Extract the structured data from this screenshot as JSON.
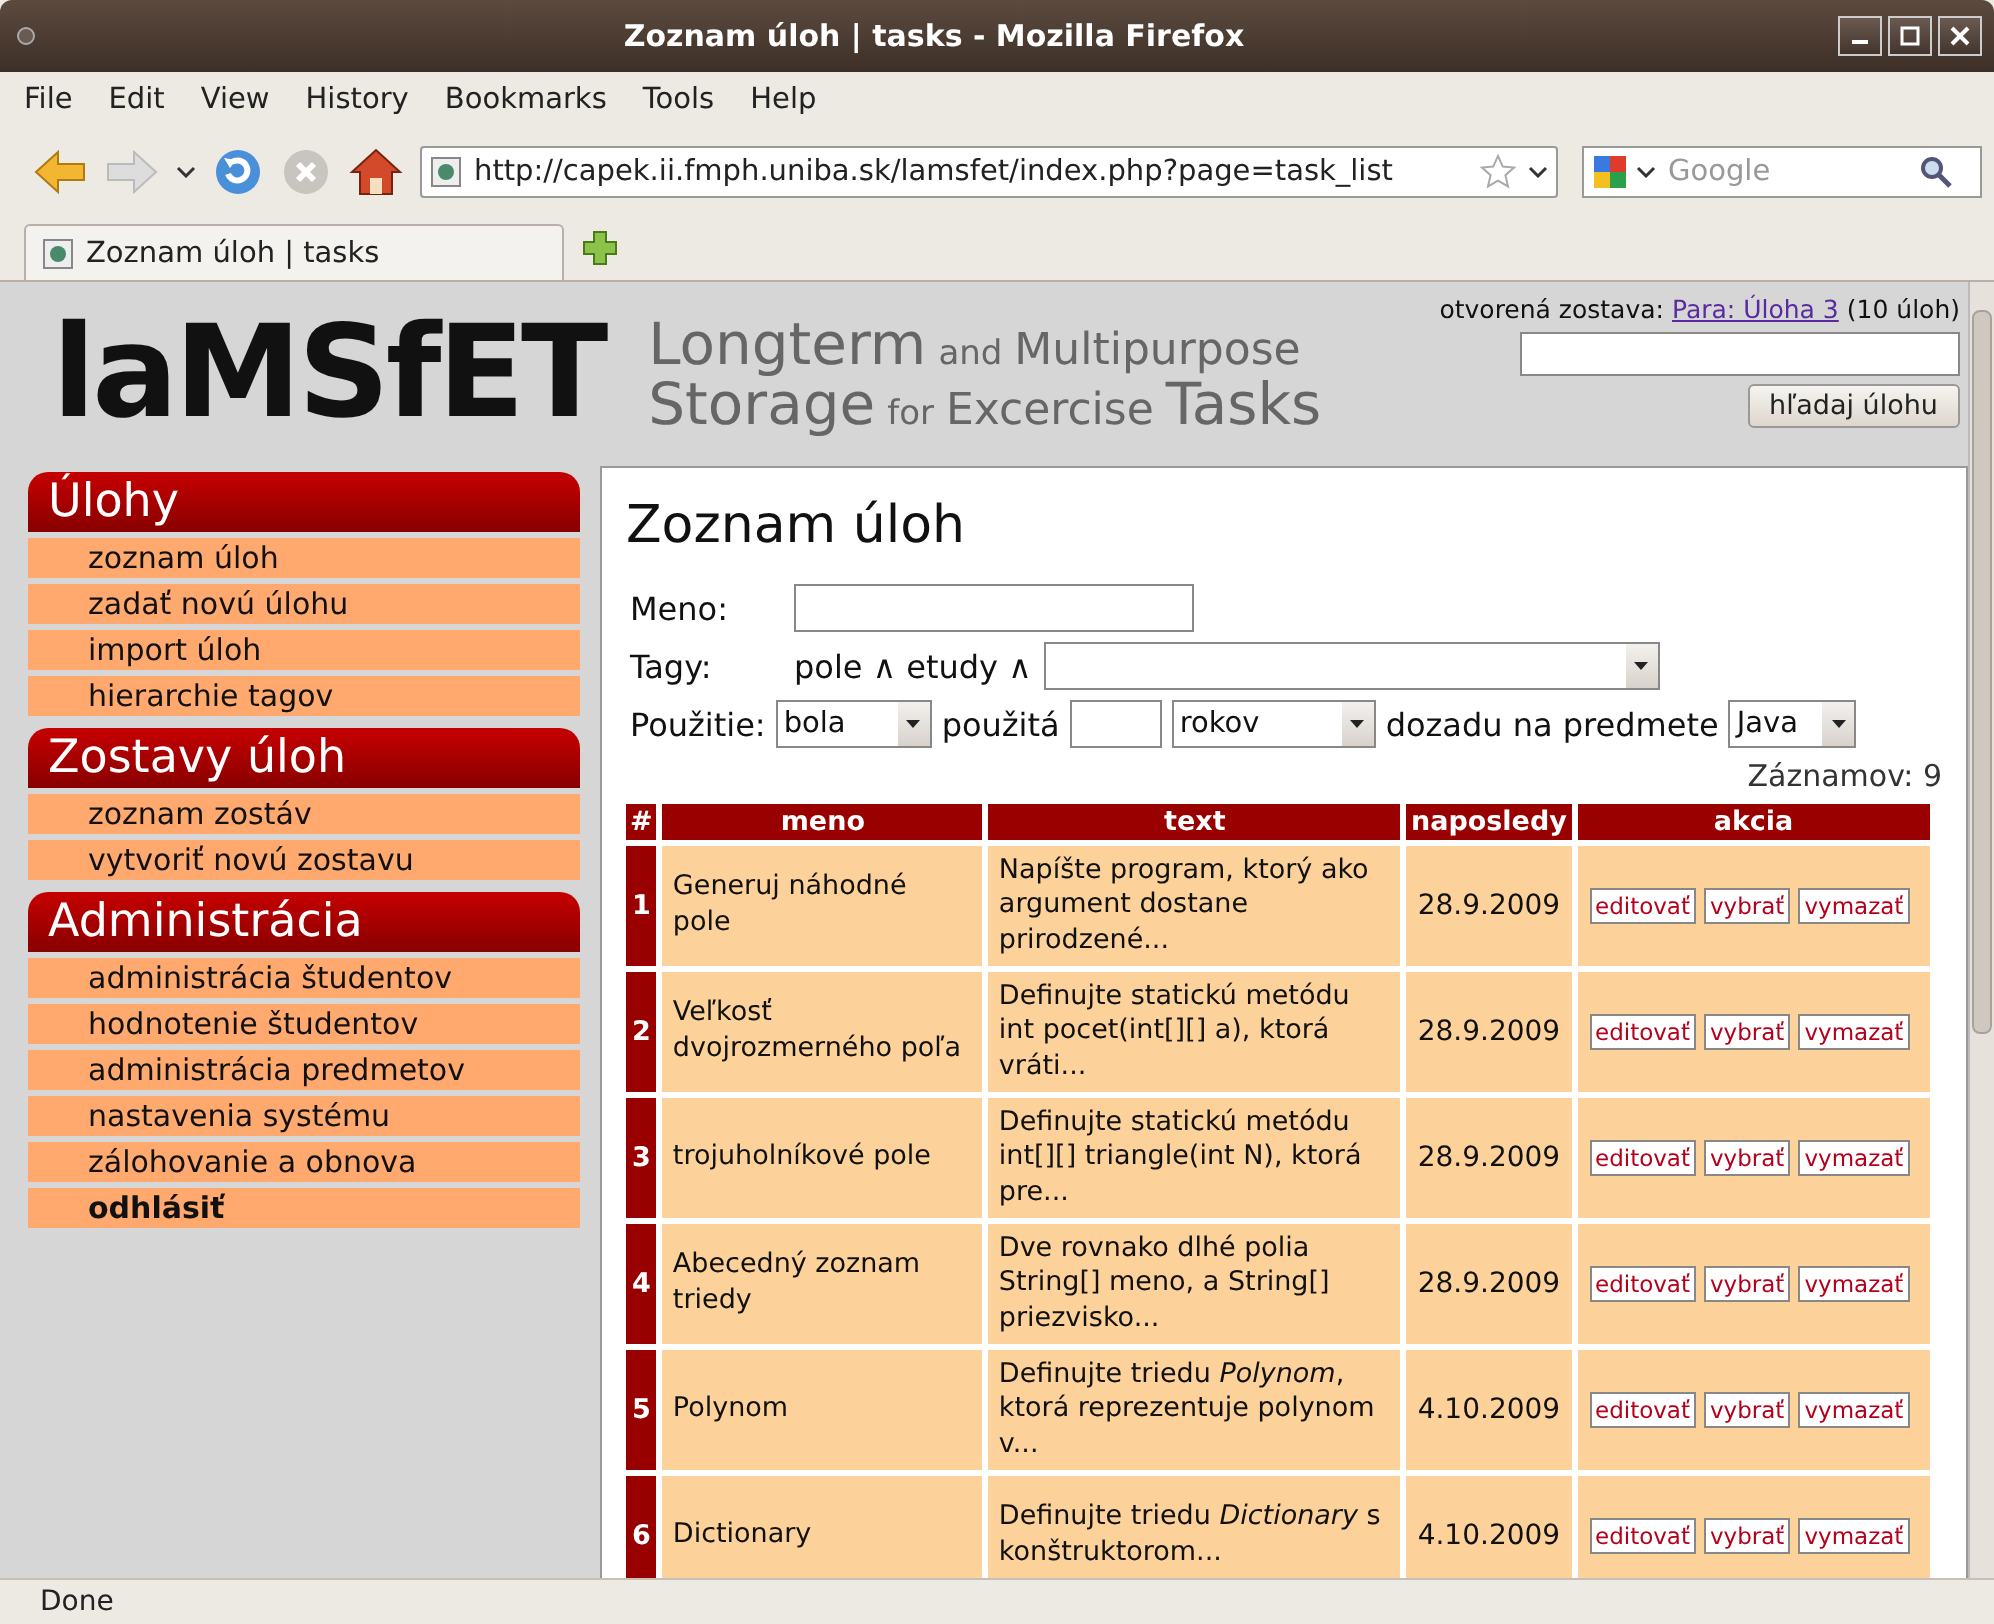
{
  "window": {
    "title": "Zoznam úloh | tasks - Mozilla Firefox"
  },
  "menu": [
    "File",
    "Edit",
    "View",
    "History",
    "Bookmarks",
    "Tools",
    "Help"
  ],
  "toolbar": {
    "url": "http://capek.ii.fmph.uniba.sk/lamsfet/index.php?page=task_list",
    "search_placeholder": "Google"
  },
  "tabs": [
    {
      "label": "Zoznam úloh | tasks",
      "selected": true
    }
  ],
  "header": {
    "logo": "laMSfET",
    "tagline": [
      [
        {
          "text": "Longterm",
          "kind": "big"
        },
        {
          "text": "and",
          "kind": "small"
        },
        {
          "text": "Multipurpose",
          "kind": "mid"
        }
      ],
      [
        {
          "text": "Storage",
          "kind": "big"
        },
        {
          "text": "for",
          "kind": "small"
        },
        {
          "text": "Excercise",
          "kind": "mid"
        },
        {
          "text": "Tasks",
          "kind": "big"
        }
      ]
    ],
    "open_set_label": "otvorená zostava:",
    "open_set_link": "Para: Úloha 3",
    "open_set_count": "(10 úloh)",
    "search_button": "hľadaj úlohu"
  },
  "sidebar": [
    {
      "title": "Úlohy",
      "items": [
        {
          "label": "zoznam úloh",
          "bold": false
        },
        {
          "label": "zadať novú úlohu",
          "bold": false
        },
        {
          "label": "import úloh",
          "bold": false
        },
        {
          "label": "hierarchie tagov",
          "bold": false
        }
      ]
    },
    {
      "title": "Zostavy úloh",
      "items": [
        {
          "label": "zoznam zostáv",
          "bold": false
        },
        {
          "label": "vytvoriť novú zostavu",
          "bold": false
        }
      ]
    },
    {
      "title": "Administrácia",
      "items": [
        {
          "label": "administrácia študentov",
          "bold": false
        },
        {
          "label": "hodnotenie študentov",
          "bold": false
        },
        {
          "label": "administrácia predmetov",
          "bold": false
        },
        {
          "label": "nastavenia systému",
          "bold": false
        },
        {
          "label": "zálohovanie a obnova",
          "bold": false
        },
        {
          "label": "odhlásiť",
          "bold": true
        }
      ]
    }
  ],
  "main": {
    "title": "Zoznam úloh",
    "filters": {
      "name_label": "Meno:",
      "tags_label": "Tagy:",
      "tags": "pole ∧ etudy ∧",
      "usage_label": "Použitie:",
      "usage_select": "bola",
      "used_label": "použitá",
      "years_select": "rokov",
      "back_label": "dozadu na predmete",
      "subject_select": "Java"
    },
    "count": "Záznamov: 9",
    "table": {
      "columns": [
        "#",
        "meno",
        "text",
        "naposledy",
        "akcia"
      ],
      "rows": [
        {
          "num": "1",
          "name": "Generuj náhodné pole",
          "text": "Napíšte program, ktorý ako argument dostane prirodzené...",
          "date": "28.9.2009",
          "actions": [
            "editovať",
            "vybrať",
            "vymazať"
          ]
        },
        {
          "num": "2",
          "name": "Veľkosť dvojrozmerného poľa",
          "text": "Definujte statickú metódu int pocet(int[][] a), ktorá vráti...",
          "date": "28.9.2009",
          "actions": [
            "editovať",
            "vybrať",
            "vymazať"
          ]
        },
        {
          "num": "3",
          "name": "trojuholníkové pole",
          "text": "Definujte statickú metódu int[][] triangle(int N), ktorá pre...",
          "date": "28.9.2009",
          "actions": [
            "editovať",
            "vybrať",
            "vymazať"
          ]
        },
        {
          "num": "4",
          "name": "Abecedný zoznam triedy",
          "text": "Dve rovnako dlhé polia String[] meno, a String[] priezvisko...",
          "date": "28.9.2009",
          "actions": [
            "editovať",
            "vybrať",
            "vymazať"
          ]
        },
        {
          "num": "5",
          "name": "Polynom",
          "text": "Definujte triedu *Polynom*, ktorá reprezentuje polynom v...",
          "date": "4.10.2009",
          "actions": [
            "editovať",
            "vybrať",
            "vymazať"
          ]
        },
        {
          "num": "6",
          "name": "Dictionary",
          "text": "Definujte triedu *Dictionary* s konštruktorom...",
          "date": "4.10.2009",
          "actions": [
            "editovať",
            "vybrať",
            "vymazať"
          ]
        }
      ]
    }
  },
  "status_bar": "Done"
}
